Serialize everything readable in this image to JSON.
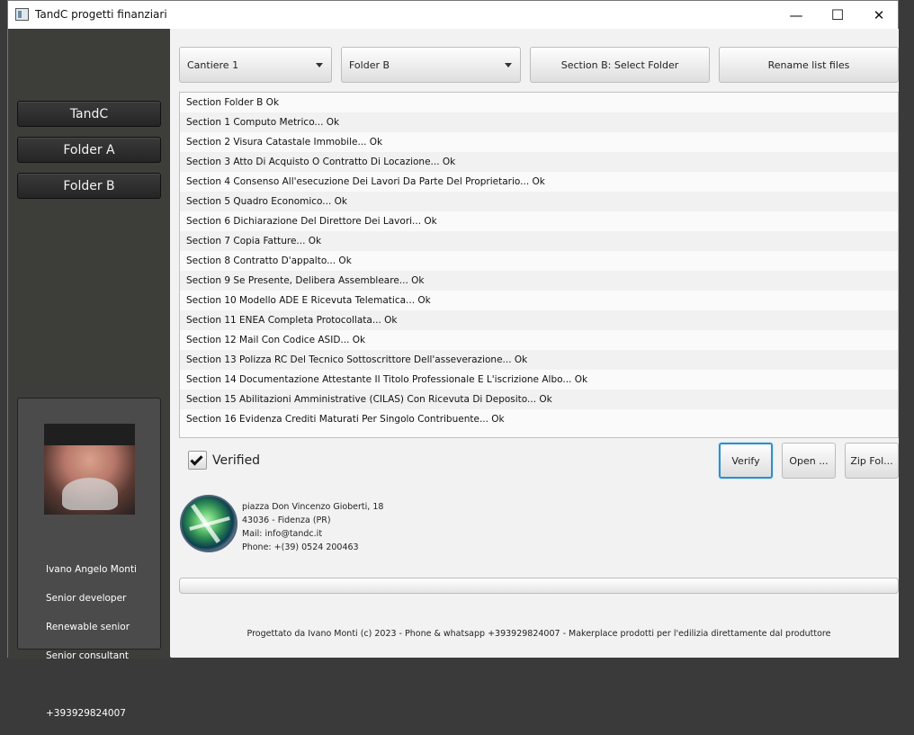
{
  "window": {
    "title": "TandC progetti finanziari",
    "minimize_icon": "—",
    "maximize_icon": "☐",
    "close_icon": "✕"
  },
  "sidebar": {
    "items": [
      "TandC",
      "Folder A",
      "Folder B"
    ],
    "profile": {
      "name": "Ivano Angelo Monti",
      "role1": "Senior developer",
      "role2": "Renewable senior",
      "role3": "Senior consultant",
      "phone": "+393929824007"
    }
  },
  "toolbar": {
    "site_select": "Cantiere 1",
    "folder_select": "Folder B",
    "select_folder_button": "Section B: Select Folder",
    "rename_button": "Rename list files"
  },
  "list": [
    "Section Folder B Ok",
    "Section 1 Computo Metrico...  Ok",
    "Section 2 Visura Catastale Immobile...  Ok",
    "Section 3 Atto Di Acquisto O Contratto Di Locazione...  Ok",
    "Section 4 Consenso All'esecuzione Dei Lavori Da Parte Del Proprietario...  Ok",
    "Section 5 Quadro Economico...  Ok",
    "Section 6 Dichiarazione Del Direttore Dei Lavori...  Ok",
    "Section 7 Copia Fatture...  Ok",
    "Section 8 Contratto D'appalto...  Ok",
    "Section 9 Se Presente, Delibera Assembleare...  Ok",
    "Section 10 Modello ADE E Ricevuta Telematica...  Ok",
    "Section 11 ENEA Completa Protocollata...  Ok",
    "Section 12 Mail Con Codice ASID...  Ok",
    "Section 13 Polizza RC Del Tecnico Sottoscrittore Dell'asseverazione...  Ok",
    "Section 14 Documentazione Attestante Il Titolo Professionale E L'iscrizione Albo...  Ok",
    "Section 15 Abilitazioni Amministrative (CILAS) Con Ricevuta Di Deposito...  Ok",
    "Section 16 Evidenza Crediti Maturati Per Singolo Contribuente... Ok"
  ],
  "status": {
    "verified_label": "Verified",
    "verified_checked": true,
    "verify_button": "Verify",
    "open_button": "Open ...",
    "zip_button": "Zip Fol..."
  },
  "contact": {
    "address": "piazza Don Vincenzo Gioberti, 18",
    "city": "43036 - Fidenza (PR)",
    "mail": "Mail: info@tandc.it",
    "phone": "Phone: +(39) 0524 200463"
  },
  "footer": "Progettato da Ivano Monti (c) 2023 - Phone & whatsapp +393929824007 - Makerplace prodotti per l'edilizia direttamente dal produttore"
}
